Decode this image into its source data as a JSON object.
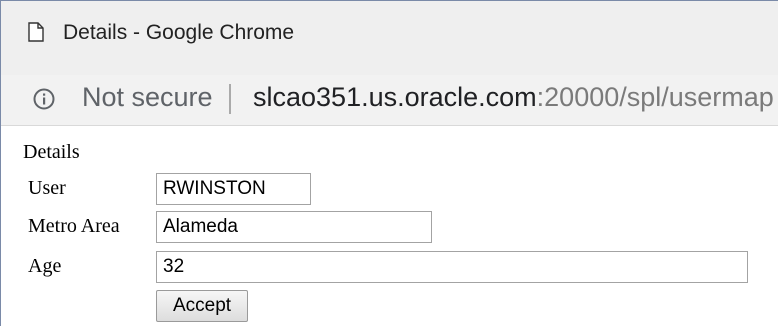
{
  "window": {
    "title": "Details - Google Chrome"
  },
  "address_bar": {
    "security_label": "Not secure",
    "url_host": "slcao351.us.oracle.com",
    "url_rest": ":20000/spl/usermap"
  },
  "form": {
    "heading": "Details",
    "user": {
      "label": "User",
      "value": "RWINSTON"
    },
    "metro_area": {
      "label": "Metro Area",
      "value": "Alameda"
    },
    "age": {
      "label": "Age",
      "value": "32"
    },
    "accept_label": "Accept"
  }
}
